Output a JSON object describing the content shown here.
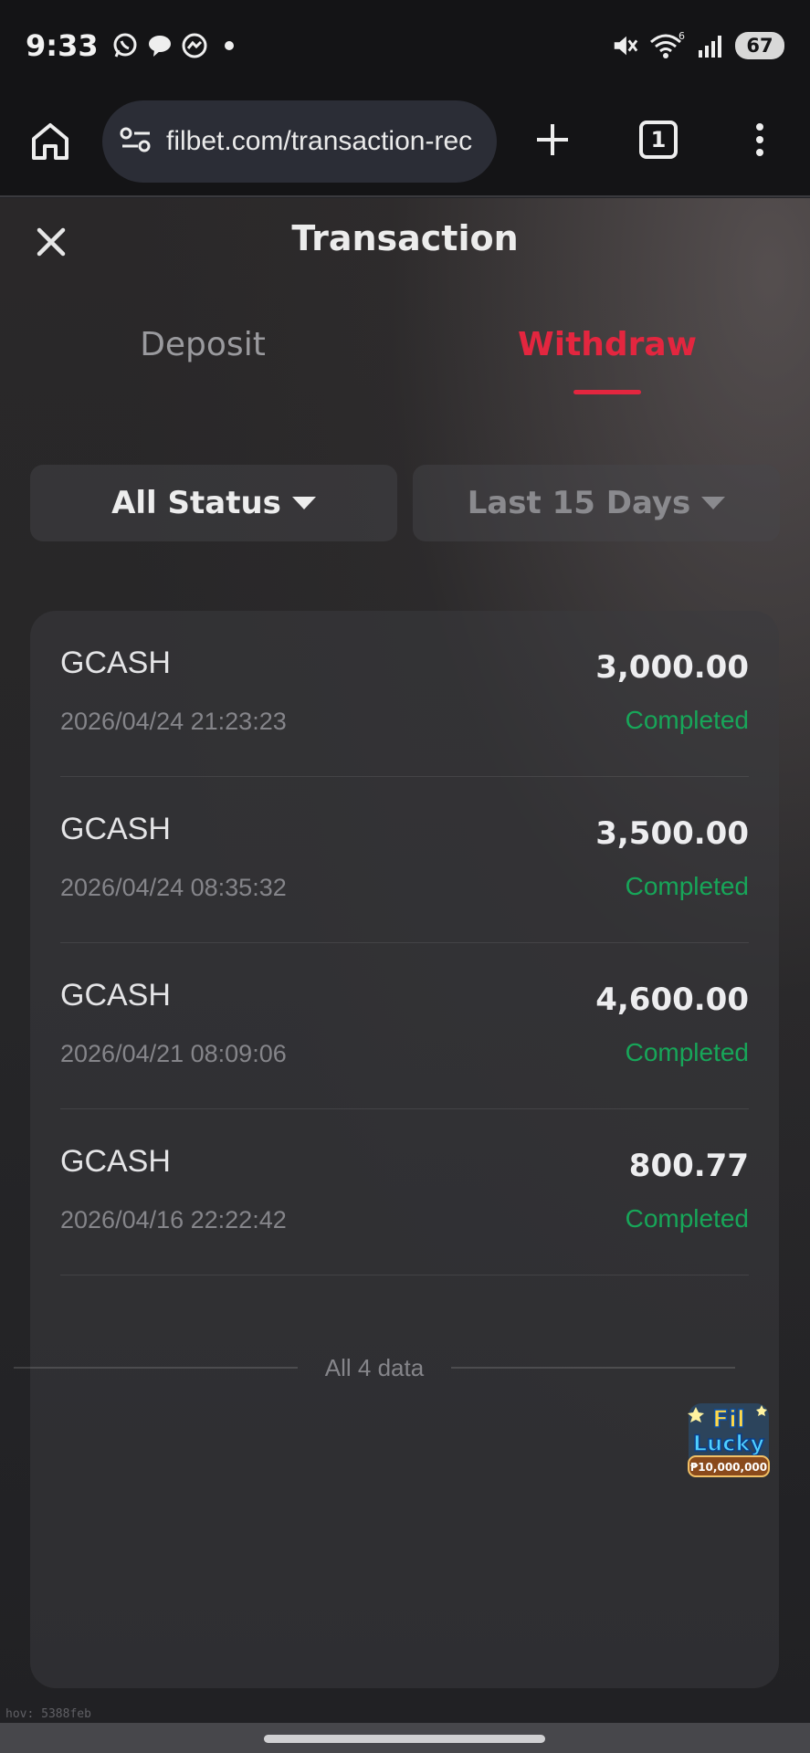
{
  "status_bar": {
    "time": "9:33",
    "battery": "67",
    "signal_label": "6"
  },
  "browser": {
    "url": "filbet.com/transaction-rec",
    "tab_count": "1"
  },
  "page": {
    "title": "Transaction",
    "tabs": [
      {
        "label": "Deposit",
        "active": false
      },
      {
        "label": "Withdraw",
        "active": true
      }
    ],
    "filters": {
      "status": "All Status",
      "period": "Last 15 Days"
    },
    "transactions": [
      {
        "method": "GCASH",
        "date": "2026/04/24 21:23:23",
        "amount": "3,000.00",
        "status": "Completed"
      },
      {
        "method": "GCASH",
        "date": "2026/04/24 08:35:32",
        "amount": "3,500.00",
        "status": "Completed"
      },
      {
        "method": "GCASH",
        "date": "2026/04/21 08:09:06",
        "amount": "4,600.00",
        "status": "Completed"
      },
      {
        "method": "GCASH",
        "date": "2026/04/16 22:22:42",
        "amount": "800.77",
        "status": "Completed"
      }
    ],
    "summary": "All 4 data",
    "promo": {
      "line1": "Fil",
      "line2": "Lucky",
      "prize": "₱10,000,000"
    },
    "footer_hash": "hov: 5388feb"
  },
  "colors": {
    "accent": "#e3263f",
    "success": "#17a659",
    "background": "#232326"
  }
}
